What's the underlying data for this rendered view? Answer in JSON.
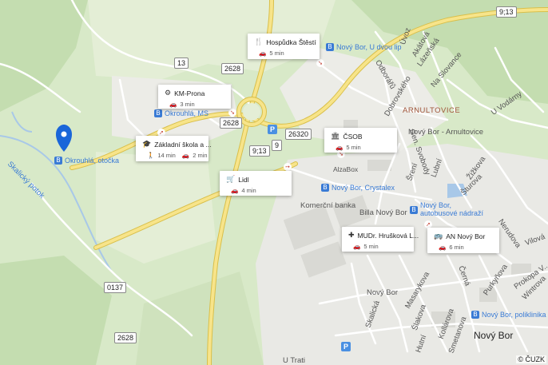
{
  "copyright": "© ČUZK",
  "road_numbers": {
    "r913_top": "9;13",
    "r13": "13",
    "r2628_a": "2628",
    "r2628_b": "2628",
    "r26320": "26320",
    "r913_mid": "9;13",
    "r9": "9",
    "r0137": "0137",
    "r2628_c": "2628"
  },
  "streets": {
    "ukoz": "Úvoz",
    "akatova": "Akátová",
    "lazenska": "Lázeňská",
    "na_slovance": "Na Slovance",
    "odborar": "Odborářů",
    "dobrovskeho": "Dobrovského",
    "uvodarny": "U Vodárny",
    "gen_svoboda": "Gen. Svobody",
    "sreni": "Šrení",
    "lubni": "Lubní",
    "zizkova": "Žižkova",
    "sturova": "Šturova",
    "nerudova": "Nerudova",
    "vilova": "Vilová",
    "skalicky_potok": "Skalický potok",
    "komercni_banka": "Komerční banka",
    "bila_novy_bor": "Billa Nový Bor",
    "skalicka": "Skalická",
    "masarykova": "Masarykova",
    "slakova": "Šlakova",
    "kollarova": "Kollárova",
    "smetanova": "Smetanova",
    "hutni": "Hutní",
    "cerna": "Černá",
    "purkynova": "Purkyňova",
    "prokopa_velikeho": "Prokopa V...",
    "wintrova": "Wintrova",
    "u_trati": "U Trati",
    "arnultovice": "ARNULTOVICE",
    "novy_bor_town": "Nový Bor",
    "novy_bor_small": "Nový Bor",
    "alzabox": "AlzaBox",
    "novy_bor_arnultovice": "Nový Bor - Arnultovice"
  },
  "bus_stops": {
    "u_dvou_lip": "Nový Bor, U dvou lip",
    "okrouhla_ms": "Okrouhlá, MS",
    "okrouhla_otocka": "Okrouhlá, otočka",
    "crystalex": "Nový Bor, Crystalex",
    "autobusove_nadrazi": "Nový Bor, autobusové nádraží",
    "poliklinika": "Nový Bor, poliklinika"
  },
  "poi_cards": [
    {
      "id": "hospudka",
      "title": "Hospůdka Štěstí",
      "icon": "restaurant-icon",
      "glyph": "🍴",
      "times": [
        {
          "icon": "car-icon",
          "glyph": "🚗",
          "text": "5 min"
        }
      ]
    },
    {
      "id": "kmprona",
      "title": "KM-Prona",
      "icon": "company-icon",
      "glyph": "⚙",
      "times": [
        {
          "icon": "car-icon",
          "glyph": "🚗",
          "text": "3 min"
        }
      ]
    },
    {
      "id": "zakladni",
      "title": "Základní škola a ...",
      "icon": "school-icon",
      "glyph": "🎓",
      "times": [
        {
          "icon": "walk-icon",
          "glyph": "🚶",
          "text": "14 min"
        },
        {
          "icon": "car-icon",
          "glyph": "🚗",
          "text": "2 min"
        }
      ]
    },
    {
      "id": "csob",
      "title": "ČSOB",
      "icon": "bank-icon",
      "glyph": "🏛",
      "times": [
        {
          "icon": "car-icon",
          "glyph": "🚗",
          "text": "5 min"
        }
      ]
    },
    {
      "id": "lidl",
      "title": "Lidl",
      "icon": "shop-icon",
      "glyph": "🛒",
      "times": [
        {
          "icon": "car-icon",
          "glyph": "🚗",
          "text": "4 min"
        }
      ]
    },
    {
      "id": "mudr",
      "title": "MUDr. Hrušková L...",
      "icon": "medical-icon",
      "glyph": "✚",
      "times": [
        {
          "icon": "car-icon",
          "glyph": "🚗",
          "text": "5 min"
        }
      ]
    },
    {
      "id": "annovy",
      "title": "AN Nový Bor",
      "icon": "bus-station-icon",
      "glyph": "🚌",
      "times": [
        {
          "icon": "car-icon",
          "glyph": "🚗",
          "text": "6 min"
        }
      ]
    }
  ],
  "colors": {
    "forest": "#c8dfb5",
    "meadow": "#e3edd4",
    "urban": "#eaeae6",
    "road": "#ffffff",
    "main_road": "#f7e48a",
    "water": "#a8c8e8",
    "stop_blue": "#3a7bd5",
    "pin_blue": "#1a66d9"
  }
}
